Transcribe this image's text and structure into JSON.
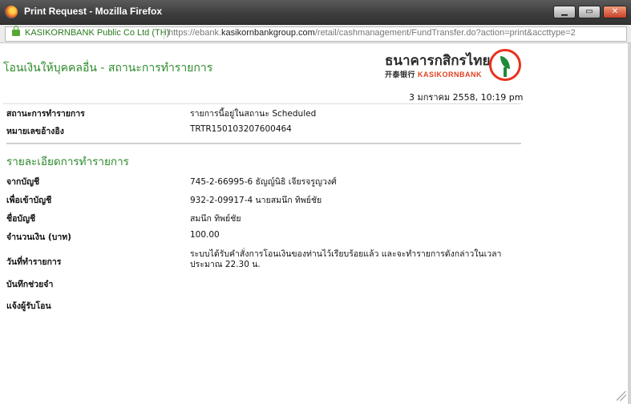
{
  "window": {
    "title": "Print Request - Mozilla Firefox",
    "minimize_label": "▁",
    "maximize_label": "▭",
    "close_label": "✕"
  },
  "addressbar": {
    "site_identity": "KASIKORNBANK Public Co Ltd (TH)",
    "url_prefix": "https://ebank.",
    "url_domain": "kasikornbankgroup.com",
    "url_path": "/retail/cashmanagement/FundTransfer.do?action=print&accttype=2"
  },
  "page": {
    "title": "โอนเงินให้บุคคลอื่น - สถานะการทำรายการ",
    "logo_thai": "ธนาคารกสิกรไทย",
    "logo_chinese": "开泰银行 ",
    "logo_english": "KASIKORNBANK",
    "datetime": "3 มกราคม 2558, 10:19 pm"
  },
  "status_rows": [
    {
      "label": "สถานะการทำรายการ",
      "value": "รายการนี้อยู่ในสถานะ Scheduled"
    },
    {
      "label": "หมายเลขอ้างอิง",
      "value": "TRTR150103207600464"
    }
  ],
  "details": {
    "section_title": "รายละเอียดการทำรายการ",
    "rows": [
      {
        "label": "จากบัญชี",
        "value": "745-2-66995-6 ธัญญ์นิธิ เจียรจรูญวงศ์"
      },
      {
        "label": "เพื่อเข้าบัญชี",
        "value": "932-2-09917-4 นายสมนึก ทิพย์ชัย"
      },
      {
        "label": "ชื่อบัญชี",
        "value": "สมนึก ทิพย์ชัย"
      },
      {
        "label": "จำนวนเงิน (บาท)",
        "value": "100.00"
      },
      {
        "label": "วันที่ทำรายการ",
        "value": "ระบบได้รับคำสั่งการโอนเงินของท่านไว้เรียบร้อยแล้ว และจะทำรายการดังกล่าวในเวลา ประมาณ 22.30 น."
      },
      {
        "label": "บันทึกช่วยจำ",
        "value": ""
      },
      {
        "label": "แจ้งผู้รับโอน",
        "value": ""
      }
    ]
  }
}
